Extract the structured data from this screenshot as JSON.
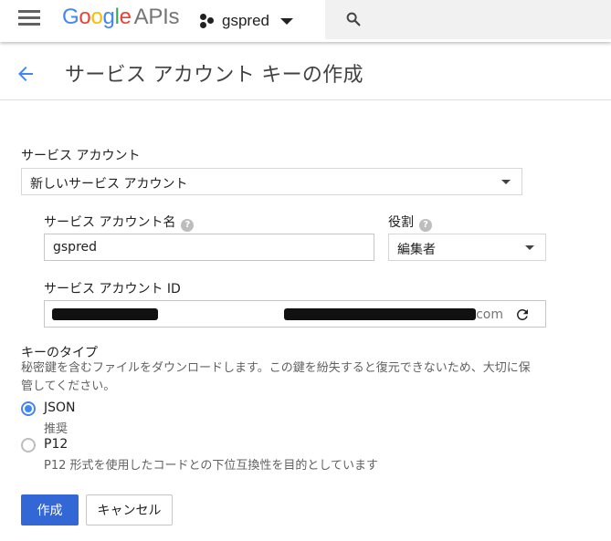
{
  "topbar": {
    "logo_letters": [
      "G",
      "o",
      "o",
      "g",
      "l",
      "e"
    ],
    "logo_suffix": "APIs",
    "project_name": "gspred",
    "icons": {
      "menu": "hamburger-menu-icon",
      "project": "project-dots-icon",
      "caret": "chevron-down-icon",
      "search": "search-icon"
    }
  },
  "header": {
    "title": "サービス アカウント キーの作成",
    "back_icon": "arrow-back-icon"
  },
  "form": {
    "service_account_label": "サービス アカウント",
    "service_account_value": "新しいサービス アカウント",
    "account_name_label": "サービス アカウント名",
    "account_name_value": "gspred",
    "role_label": "役割",
    "role_value": "編集者",
    "account_id_label": "サービス アカウント ID",
    "account_id_suffix": "com",
    "key_type_label": "キーのタイプ",
    "key_type_desc": "秘密鍵を含むファイルをダウンロードします。この鍵を紛失すると復元できないため、大切に保管してください。",
    "options": [
      {
        "label": "JSON",
        "sub": "推奨",
        "selected": true
      },
      {
        "label": "P12",
        "sub": "P12 形式を使用したコードとの下位互換性を目的としています",
        "selected": false
      }
    ]
  },
  "buttons": {
    "create": "作成",
    "cancel": "キャンセル"
  },
  "colors": {
    "primary": "#3367d6",
    "accent": "#4285f4"
  }
}
